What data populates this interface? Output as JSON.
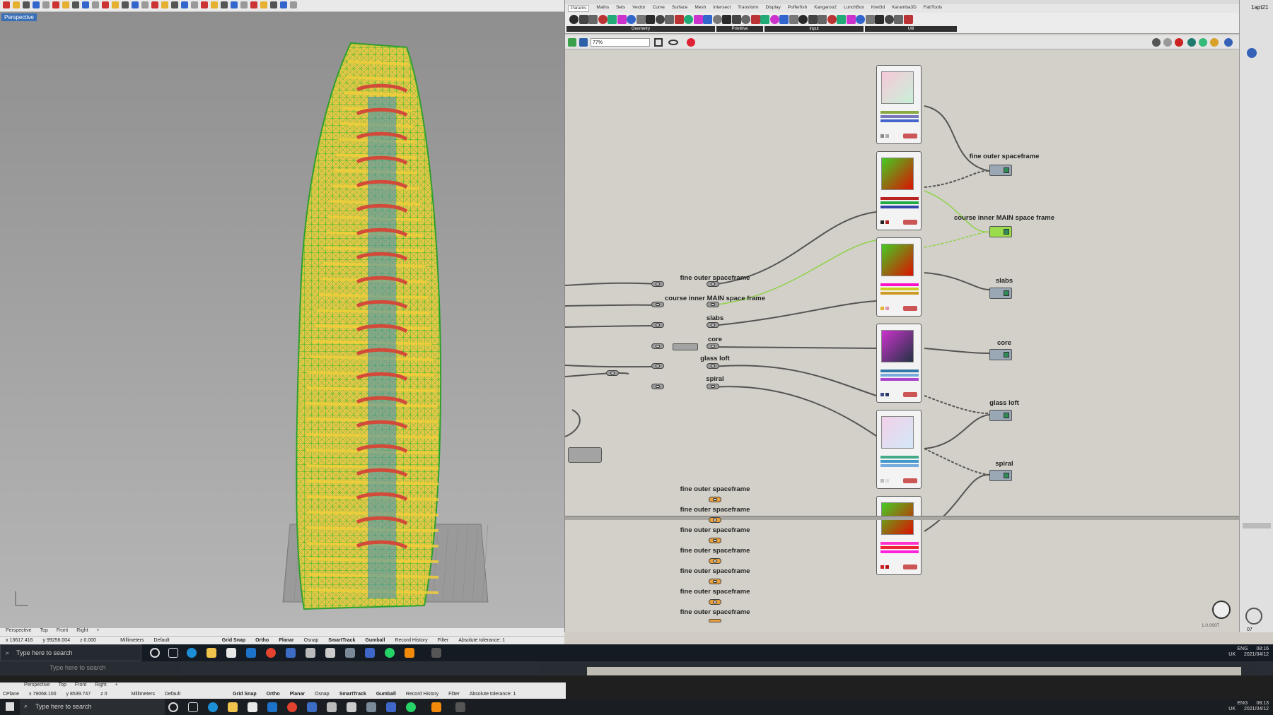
{
  "rhino": {
    "viewport_label": "Perspective",
    "viewport_tabs": [
      "Perspective",
      "Top",
      "Front",
      "Right"
    ],
    "status": {
      "x": "x 13617.416",
      "y": "y 99256.004",
      "z": "z 0.000",
      "units": "Millimeters",
      "layer": "Default",
      "grid_snap": "Grid Snap",
      "ortho": "Ortho",
      "planar": "Planar",
      "osnap": "Osnap",
      "smarttrack": "SmartTrack",
      "gumball": "Gumball",
      "record_history": "Record History",
      "filter": "Filter",
      "tolerance": "Absolute tolerance: 1"
    }
  },
  "grasshopper": {
    "tabs": [
      "Params",
      "Maths",
      "Sets",
      "Vector",
      "Curve",
      "Surface",
      "Mesh",
      "Intersect",
      "Transform",
      "Display",
      "Pufferfish",
      "Kangaroo2",
      "LunchBox",
      "Kiwi3d",
      "Karamba3D",
      "FabTools"
    ],
    "active_tab": "Params",
    "ribbon_groups": [
      "Geometry",
      "Primitive",
      "Input",
      "Util"
    ],
    "zoom": "77%",
    "version": "1.0.0007",
    "left_labels": [
      "fine outer spaceframe",
      "course inner MAIN space frame",
      "slabs",
      "core",
      "glass loft",
      "spiral"
    ],
    "right_labels": [
      "fine outer spaceframe",
      "course inner MAIN space frame",
      "slabs",
      "core",
      "glass loft",
      "spiral"
    ],
    "orange_labels": [
      "fine outer spaceframe",
      "fine outer spaceframe",
      "fine outer spaceframe",
      "fine outer spaceframe",
      "fine outer spaceframe",
      "fine outer spaceframe",
      "fine outer spaceframe"
    ]
  },
  "right_panel": {
    "top_text": "1apt21",
    "bottom_text": "07"
  },
  "taskbar": {
    "search_placeholder": "Type here to search",
    "tray_lang": "ENG",
    "tray_region": "UK",
    "time": "08:16",
    "date": "2021/04/12"
  },
  "rhino2": {
    "cplane": "CPlane",
    "x": "x 79068.100",
    "y": "y 8539.747",
    "z": "z 0",
    "units": "Millimeters",
    "layer": "Default",
    "grid_snap": "Grid Snap",
    "ortho": "Ortho",
    "planar": "Planar",
    "osnap": "Osnap",
    "smarttrack": "SmartTrack",
    "gumball": "Gumball",
    "record_history": "Record History",
    "filter": "Filter",
    "tolerance": "Absolute tolerance: 1"
  },
  "taskbar2": {
    "search_placeholder": "Type here to search",
    "tray_lang": "ENG",
    "tray_region": "UK",
    "time": "08:13",
    "date": "2021/04/12"
  },
  "colors": {
    "wire_green": "#3dbb2f",
    "slab_yellow": "#f2cf3a",
    "core_blue": "#3f8fb9",
    "spiral_red": "#d24b3a",
    "gh_canvas": "#d2d0c8"
  },
  "icons": [
    "search-icon",
    "windows-icon",
    "task-view-icon",
    "edge-icon",
    "folder-icon",
    "store-icon",
    "mail-icon",
    "chrome-icon",
    "rhino-icon",
    "grasshopper-icon",
    "whatsapp-icon",
    "vlc-icon",
    "notification-icon"
  ]
}
